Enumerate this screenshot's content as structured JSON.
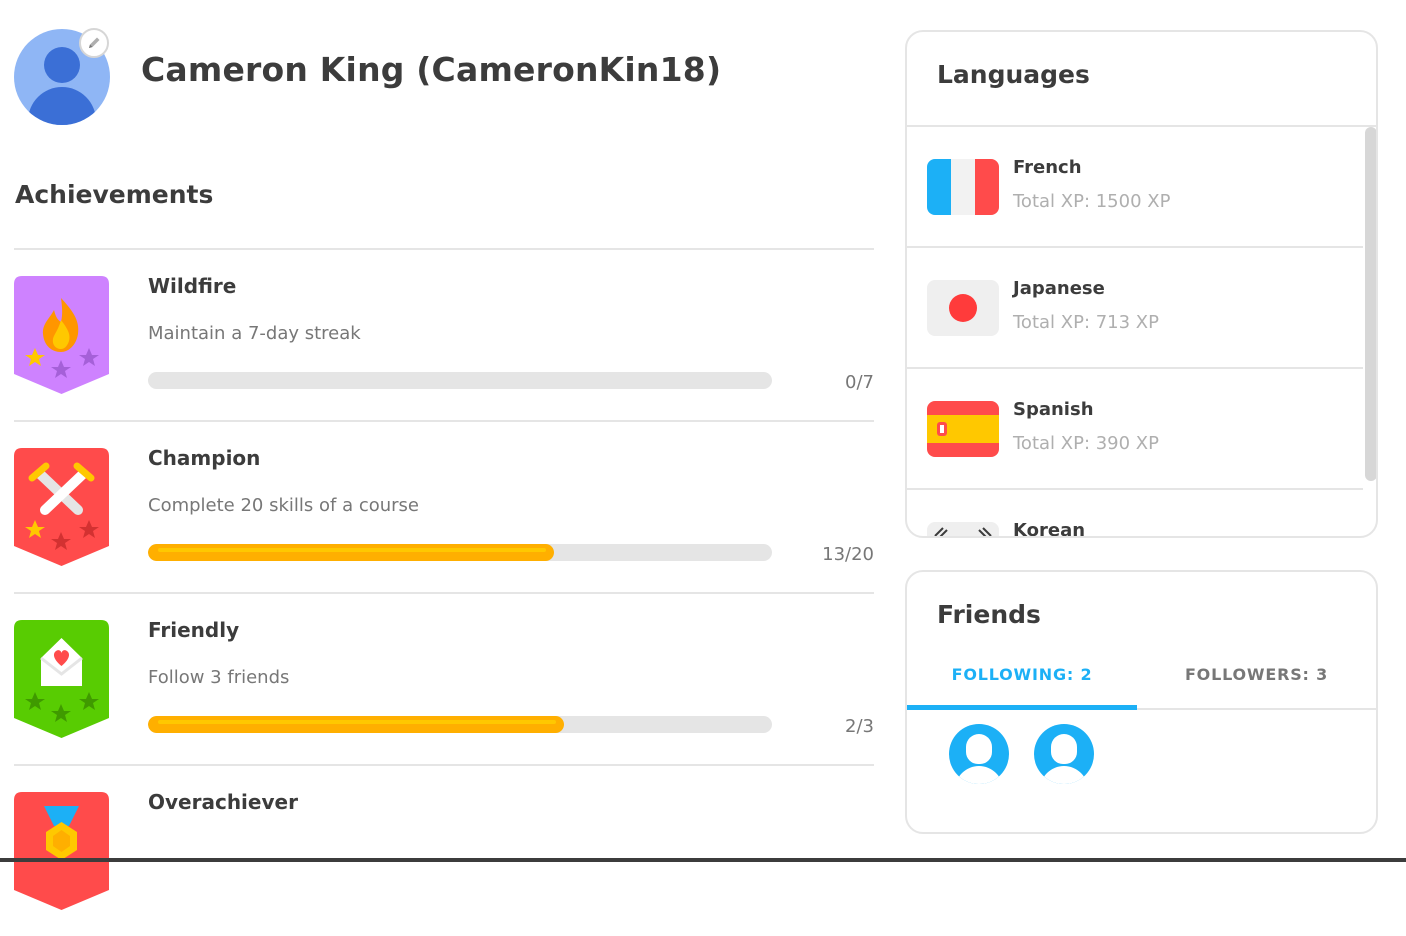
{
  "profile": {
    "name": "Cameron King (CameronKin18)",
    "avatar_icon": "user-avatar-icon",
    "edit_icon": "pencil-icon"
  },
  "achievements": {
    "title": "Achievements",
    "items": [
      {
        "title": "Wildfire",
        "description": "Maintain a 7-day streak",
        "count": "0/7",
        "progress": 0.0,
        "badge_color": "#ce82ff",
        "icon": "fire-icon"
      },
      {
        "title": "Champion",
        "description": "Complete 20 skills of a course",
        "count": "13/20",
        "progress": 0.65,
        "badge_color": "#ff4b4b",
        "icon": "swords-icon"
      },
      {
        "title": "Friendly",
        "description": "Follow 3 friends",
        "count": "2/3",
        "progress": 0.667,
        "badge_color": "#58cc02",
        "icon": "envelope-heart-icon"
      },
      {
        "title": "Overachiever",
        "description": "",
        "count": "",
        "progress": 0.0,
        "badge_color": "#ff4b4b",
        "icon": "medal-icon"
      }
    ]
  },
  "languages": {
    "title": "Languages",
    "items": [
      {
        "name": "French",
        "xp": "Total XP: 1500 XP",
        "flag": "flag-france-icon"
      },
      {
        "name": "Japanese",
        "xp": "Total XP: 713 XP",
        "flag": "flag-japan-icon"
      },
      {
        "name": "Spanish",
        "xp": "Total XP: 390 XP",
        "flag": "flag-spain-icon"
      },
      {
        "name": "Korean",
        "xp": "",
        "flag": "flag-korea-icon"
      }
    ]
  },
  "friends": {
    "title": "Friends",
    "tabs": {
      "following": "FOLLOWING: 2",
      "followers": "FOLLOWERS: 3"
    },
    "active_tab": "following",
    "accent_color": "#1cb0f6"
  }
}
